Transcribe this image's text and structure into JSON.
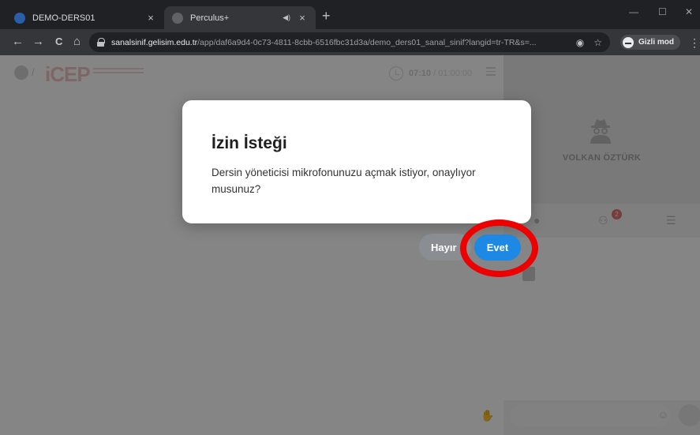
{
  "browser": {
    "tabs": [
      {
        "title": "DEMO-DERS01",
        "active": false
      },
      {
        "title": "Perculus+",
        "active": true
      }
    ],
    "new_tab_symbol": "+",
    "close_symbol": "×",
    "window_controls": {
      "minimize": "—",
      "maximize": "☐",
      "close": "✕"
    },
    "nav": {
      "back": "←",
      "forward": "→",
      "reload": "C",
      "home": "⌂"
    },
    "url": {
      "host": "sanalsinif.gelisim.edu.tr",
      "path": "/app/daf6a9d4-0c73-4811-8cbb-6516fbc31d3a/demo_ders01_sanal_sinif?langid=tr-TR&s=..."
    },
    "incognito_label": "Gizli mod",
    "menu_symbol": "⋮"
  },
  "app": {
    "logo_text": "iCEP",
    "timer": {
      "elapsed": "07:10",
      "total": " / 01:00:00"
    },
    "video": {
      "participant_name": "VOLKAN ÖZTÜRK"
    },
    "side_tabs": {
      "users_badge": "2"
    }
  },
  "dialog": {
    "title": "İzin İsteği",
    "message": "Dersin yöneticisi mikrofonunuzu açmak istiyor, onaylıyor musunuz?",
    "reject_label": "Hayır",
    "accept_label": "Evet"
  },
  "colors": {
    "accept": "#1e88e5",
    "reject": "#8a8d91",
    "highlight": "#ec0000",
    "chrome_dark": "#202124"
  },
  "icons": [
    "lock-icon",
    "target-icon",
    "star-icon",
    "incognito-icon",
    "clock-icon",
    "menu-icon",
    "spy-avatar-icon",
    "chat-icon",
    "users-icon",
    "list-icon",
    "emoji-icon",
    "raise-hand-icon"
  ]
}
